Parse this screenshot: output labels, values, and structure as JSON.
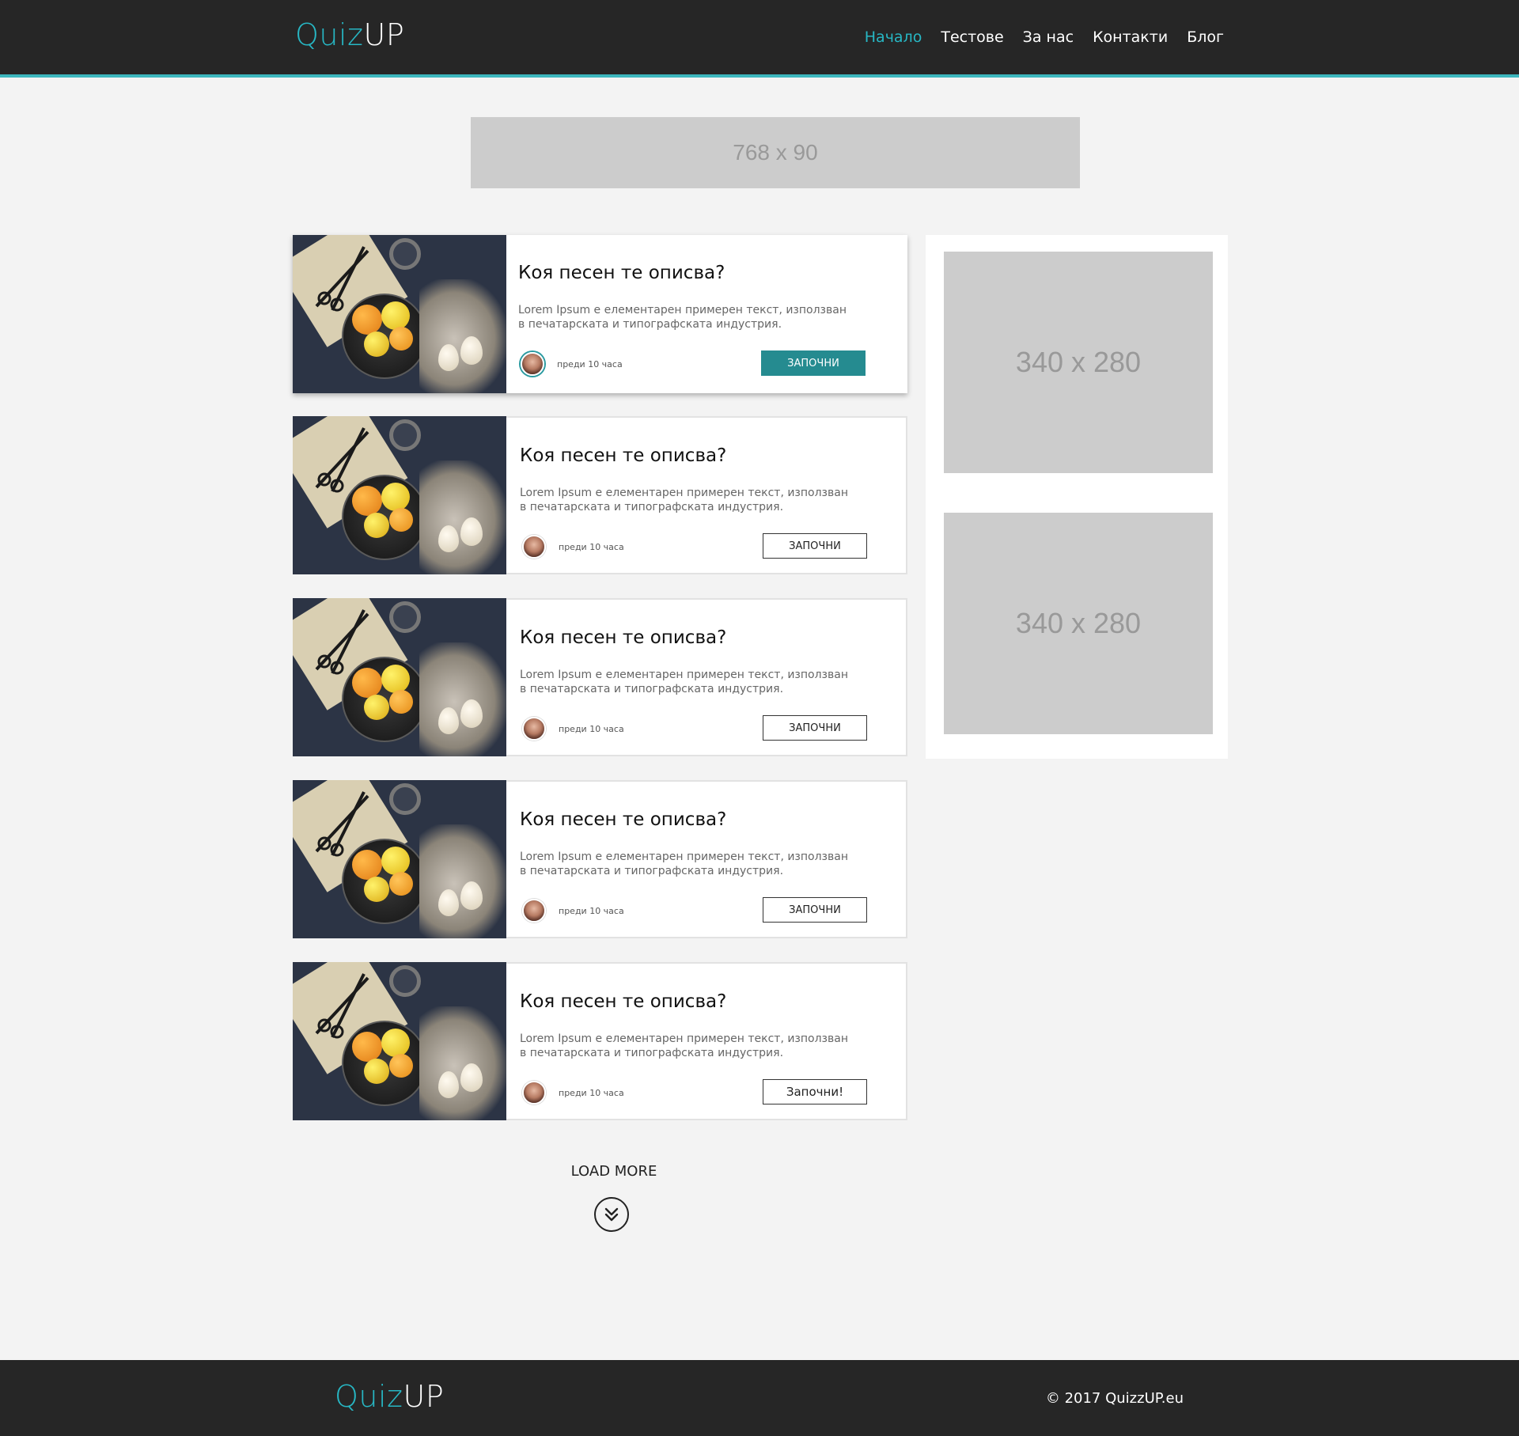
{
  "header": {
    "logo_part1": "Quiz",
    "logo_part2": "UP",
    "nav": [
      {
        "label": "Начало",
        "active": true
      },
      {
        "label": "Тестове",
        "active": false
      },
      {
        "label": "За нас",
        "active": false
      },
      {
        "label": "Контакти",
        "active": false
      },
      {
        "label": "Блог",
        "active": false
      }
    ]
  },
  "ads": {
    "top": "768 x 90",
    "side1": "340 x 280",
    "side2": "340 x 280"
  },
  "cards": [
    {
      "title": "Коя песен те описва?",
      "desc_line1": "Lorem Ipsum е елементарен примерен текст, използван",
      "desc_line2": " в печатарската и типографската индустрия.",
      "time": "преди 10 часа",
      "button": "ЗАПОЧНИ"
    },
    {
      "title": "Коя песен те описва?",
      "desc_line1": "Lorem Ipsum е елементарен примерен текст, използван",
      "desc_line2": " в печатарската и типографската индустрия.",
      "time": "преди 10 часа",
      "button": "ЗАПОЧНИ"
    },
    {
      "title": "Коя песен те описва?",
      "desc_line1": "Lorem Ipsum е елементарен примерен текст, използван",
      "desc_line2": " в печатарската и типографската индустрия.",
      "time": "преди 10 часа",
      "button": "ЗАПОЧНИ"
    },
    {
      "title": "Коя песен те описва?",
      "desc_line1": "Lorem Ipsum е елементарен примерен текст, използван",
      "desc_line2": " в печатарската и типографската индустрия.",
      "time": "преди 10 часа",
      "button": "ЗАПОЧНИ"
    },
    {
      "title": "Коя песен те описва?",
      "desc_line1": "Lorem Ipsum е елементарен примерен текст, използван",
      "desc_line2": " в печатарската и типографската индустрия.",
      "time": "преди 10 часа",
      "button": "Започни!"
    }
  ],
  "load_more": {
    "label": "LOAD MORE",
    "icon": "double-chevron-down-icon"
  },
  "footer": {
    "logo_part1": "Quiz",
    "logo_part2": "UP",
    "copyright": "© 2017 QuizzUP.eu"
  },
  "colors": {
    "accent": "#27b7c4",
    "button_primary": "#258b90",
    "header_bg": "#262626",
    "page_bg": "#f3f3f3"
  }
}
